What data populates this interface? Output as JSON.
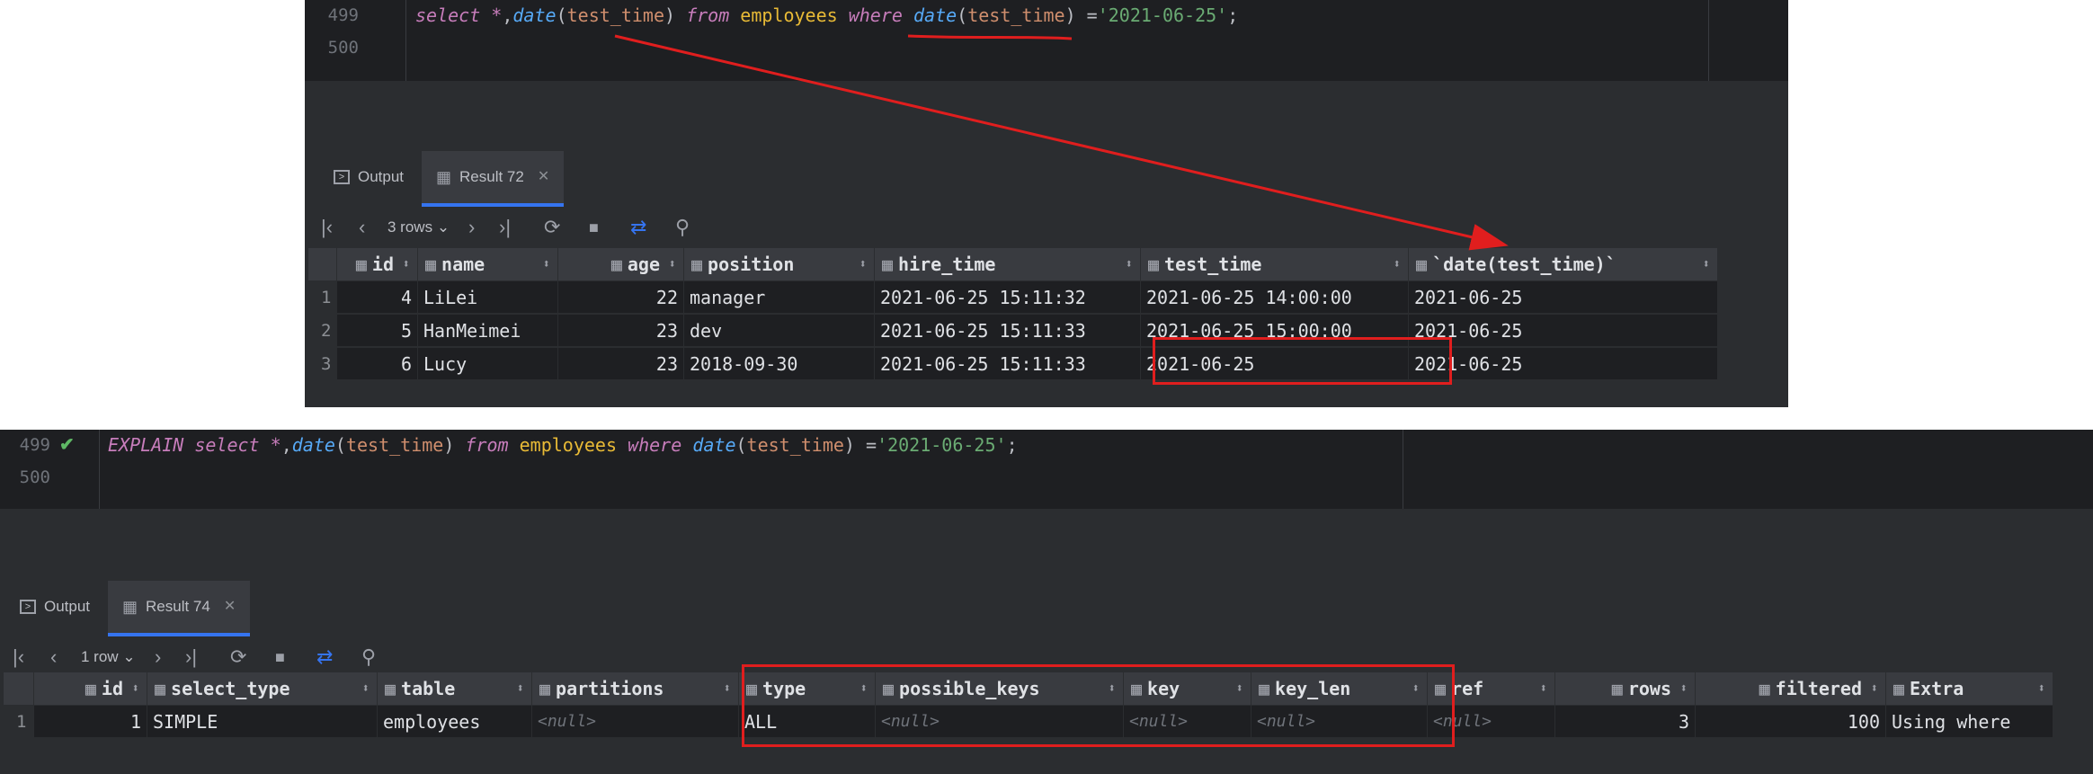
{
  "top": {
    "editor": {
      "line_numbers": [
        "499",
        "500"
      ],
      "query_tokens": [
        {
          "text": "select",
          "cls": "k"
        },
        {
          "text": " ",
          "cls": "p"
        },
        {
          "text": "*",
          "cls": "k"
        },
        {
          "text": ",",
          "cls": "p"
        },
        {
          "text": "date",
          "cls": "f"
        },
        {
          "text": "(",
          "cls": "p"
        },
        {
          "text": "test_time",
          "cls": "a"
        },
        {
          "text": ")",
          "cls": "p"
        },
        {
          "text": " ",
          "cls": "p"
        },
        {
          "text": "from",
          "cls": "k"
        },
        {
          "text": " ",
          "cls": "p"
        },
        {
          "text": "employees",
          "cls": "t"
        },
        {
          "text": " ",
          "cls": "p"
        },
        {
          "text": "where",
          "cls": "k"
        },
        {
          "text": " ",
          "cls": "p"
        },
        {
          "text": "date",
          "cls": "f"
        },
        {
          "text": "(",
          "cls": "p"
        },
        {
          "text": "test_time",
          "cls": "a"
        },
        {
          "text": ")",
          "cls": "p"
        },
        {
          "text": " =",
          "cls": "p"
        },
        {
          "text": "'2021-06-25'",
          "cls": "s"
        },
        {
          "text": ";",
          "cls": "p"
        }
      ]
    },
    "tabs": {
      "output": "Output",
      "result": "Result 72",
      "close": "✕"
    },
    "toolbar": {
      "rows": "3 rows"
    },
    "columns": [
      "id",
      "name",
      "age",
      "position",
      "hire_time",
      "test_time",
      "`date(test_time)`"
    ],
    "rows": [
      {
        "n": "1",
        "cells": [
          "4",
          "LiLei",
          "22",
          "manager",
          "2021-06-25 15:11:32",
          "2021-06-25 14:00:00",
          "2021-06-25"
        ]
      },
      {
        "n": "2",
        "cells": [
          "5",
          "HanMeimei",
          "23",
          "dev",
          "2021-06-25 15:11:33",
          "2021-06-25 15:00:00",
          "2021-06-25"
        ]
      },
      {
        "n": "3",
        "cells": [
          "6",
          "Lucy",
          "23",
          "2018-09-30",
          "2021-06-25 15:11:33",
          "2021-06-25",
          "2021-06-25"
        ]
      }
    ]
  },
  "bottom": {
    "editor": {
      "line_numbers": [
        "499",
        "500"
      ],
      "query_tokens": [
        {
          "text": "EXPLAIN",
          "cls": "k"
        },
        {
          "text": " ",
          "cls": "p"
        },
        {
          "text": "select",
          "cls": "k"
        },
        {
          "text": " ",
          "cls": "p"
        },
        {
          "text": "*",
          "cls": "k"
        },
        {
          "text": ",",
          "cls": "p"
        },
        {
          "text": "date",
          "cls": "f"
        },
        {
          "text": "(",
          "cls": "p"
        },
        {
          "text": "test_time",
          "cls": "a"
        },
        {
          "text": ")",
          "cls": "p"
        },
        {
          "text": " ",
          "cls": "p"
        },
        {
          "text": "from",
          "cls": "k"
        },
        {
          "text": " ",
          "cls": "p"
        },
        {
          "text": "employees",
          "cls": "t"
        },
        {
          "text": " ",
          "cls": "p"
        },
        {
          "text": "where",
          "cls": "k"
        },
        {
          "text": " ",
          "cls": "p"
        },
        {
          "text": "date",
          "cls": "f"
        },
        {
          "text": "(",
          "cls": "p"
        },
        {
          "text": "test_time",
          "cls": "a"
        },
        {
          "text": ")",
          "cls": "p"
        },
        {
          "text": " =",
          "cls": "p"
        },
        {
          "text": "'2021-06-25'",
          "cls": "s"
        },
        {
          "text": ";",
          "cls": "p"
        }
      ]
    },
    "tabs": {
      "output": "Output",
      "result": "Result 74",
      "close": "✕"
    },
    "toolbar": {
      "rows": "1 row"
    },
    "columns": [
      "id",
      "select_type",
      "table",
      "partitions",
      "type",
      "possible_keys",
      "key",
      "key_len",
      "ref",
      "rows",
      "filtered",
      "Extra"
    ],
    "rows": [
      {
        "n": "1",
        "cells": [
          "1",
          "SIMPLE",
          "employees",
          "<null>",
          "ALL",
          "<null>",
          "<null>",
          "<null>",
          "<null>",
          "3",
          "100",
          "Using where"
        ]
      }
    ]
  },
  "icons": {
    "first": "first-page-icon",
    "prev": "prev-page-icon",
    "next": "next-page-icon",
    "last": "last-page-icon",
    "refresh": "refresh-icon",
    "stop": "stop-icon",
    "compare": "compare-icon",
    "pin": "pin-icon",
    "table": "table-icon",
    "output": "output-icon",
    "check": "check-icon"
  },
  "colors": {
    "annotation": "#e01e1e",
    "accent": "#3574f0",
    "keyword": "#c77dbb",
    "function": "#57aaf7",
    "string": "#6aab73",
    "table": "#e8ba36"
  }
}
